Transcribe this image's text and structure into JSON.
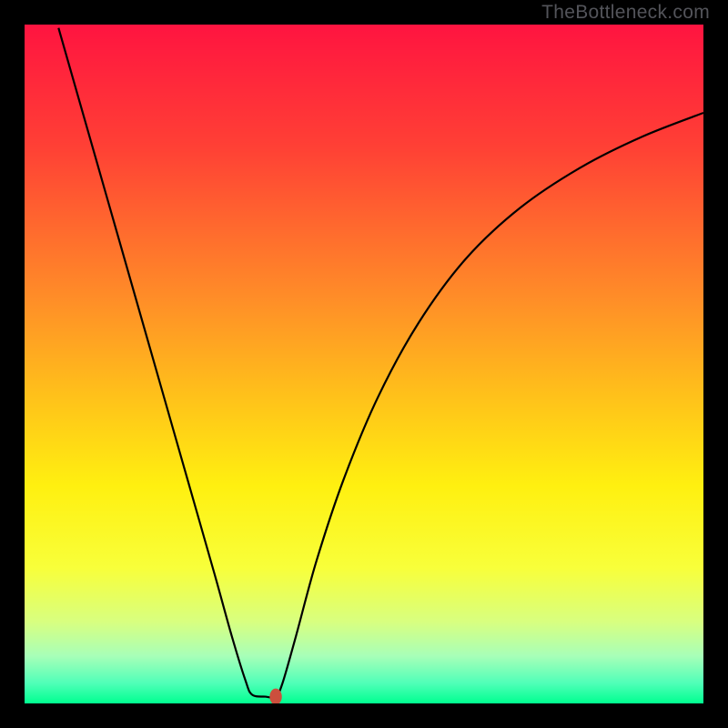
{
  "watermark": "TheBottleneck.com",
  "chart_data": {
    "type": "line",
    "title": "",
    "xlabel": "",
    "ylabel": "",
    "xlim": [
      0,
      100
    ],
    "ylim": [
      0,
      100
    ],
    "background_gradient": {
      "stops": [
        {
          "offset": 0,
          "color": "#ff1440"
        },
        {
          "offset": 18,
          "color": "#ff4035"
        },
        {
          "offset": 40,
          "color": "#ff8c28"
        },
        {
          "offset": 55,
          "color": "#ffc21a"
        },
        {
          "offset": 68,
          "color": "#fff010"
        },
        {
          "offset": 80,
          "color": "#f8ff3a"
        },
        {
          "offset": 88,
          "color": "#d8ff80"
        },
        {
          "offset": 93,
          "color": "#a8ffb8"
        },
        {
          "offset": 97,
          "color": "#50ffb8"
        },
        {
          "offset": 100,
          "color": "#00ff90"
        }
      ]
    },
    "series": [
      {
        "name": "bottleneck-curve",
        "color": "#000000",
        "stroke_width": 2.2,
        "points": [
          {
            "x": 5.0,
            "y": 99.5
          },
          {
            "x": 8.0,
            "y": 89.0
          },
          {
            "x": 12.0,
            "y": 75.0
          },
          {
            "x": 16.0,
            "y": 61.0
          },
          {
            "x": 20.0,
            "y": 47.0
          },
          {
            "x": 24.0,
            "y": 33.0
          },
          {
            "x": 28.0,
            "y": 19.0
          },
          {
            "x": 30.5,
            "y": 10.0
          },
          {
            "x": 32.5,
            "y": 3.5
          },
          {
            "x": 33.5,
            "y": 1.3
          },
          {
            "x": 35.5,
            "y": 1.0
          },
          {
            "x": 37.0,
            "y": 1.0
          },
          {
            "x": 38.0,
            "y": 3.0
          },
          {
            "x": 40.0,
            "y": 10.0
          },
          {
            "x": 43.0,
            "y": 21.0
          },
          {
            "x": 47.0,
            "y": 33.0
          },
          {
            "x": 52.0,
            "y": 45.0
          },
          {
            "x": 58.0,
            "y": 56.0
          },
          {
            "x": 65.0,
            "y": 65.5
          },
          {
            "x": 73.0,
            "y": 73.0
          },
          {
            "x": 82.0,
            "y": 79.0
          },
          {
            "x": 91.0,
            "y": 83.5
          },
          {
            "x": 100.0,
            "y": 87.0
          }
        ]
      }
    ],
    "marker": {
      "x": 37.0,
      "y": 1.0,
      "rx": 0.9,
      "ry": 1.2,
      "color": "#cc4f3d"
    }
  }
}
